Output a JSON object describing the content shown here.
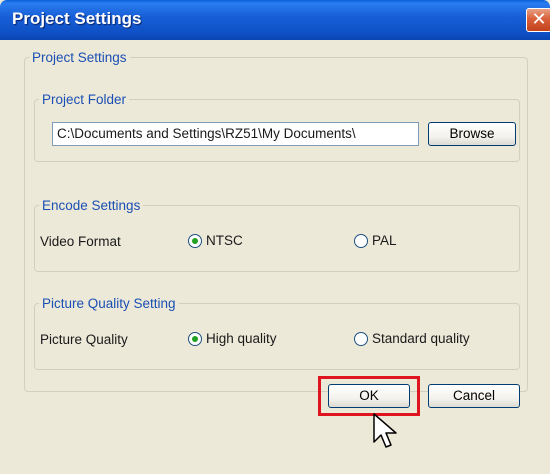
{
  "window": {
    "title": "Project Settings",
    "close_symbol": "✕"
  },
  "outer_group": {
    "legend": "Project Settings"
  },
  "project_folder": {
    "legend": "Project Folder",
    "path_value": "C:\\Documents and Settings\\RZ51\\My Documents\\",
    "browse_label": "Browse"
  },
  "encode_settings": {
    "legend": "Encode Settings",
    "label": "Video Format",
    "options": [
      {
        "label": "NTSC",
        "selected": true
      },
      {
        "label": "PAL",
        "selected": false
      }
    ]
  },
  "picture_quality": {
    "legend": "Picture Quality Setting",
    "label": "Picture Quality",
    "options": [
      {
        "label": "High quality",
        "selected": true
      },
      {
        "label": "Standard quality",
        "selected": false
      }
    ]
  },
  "footer": {
    "ok_label": "OK",
    "cancel_label": "Cancel"
  },
  "colors": {
    "title_bar": "#1860d8",
    "group_legend": "#1b4fb4",
    "highlight": "#e0141e",
    "radio_dot": "#21a121"
  },
  "icons": {
    "close": "close-icon",
    "cursor": "mouse-pointer-icon"
  }
}
